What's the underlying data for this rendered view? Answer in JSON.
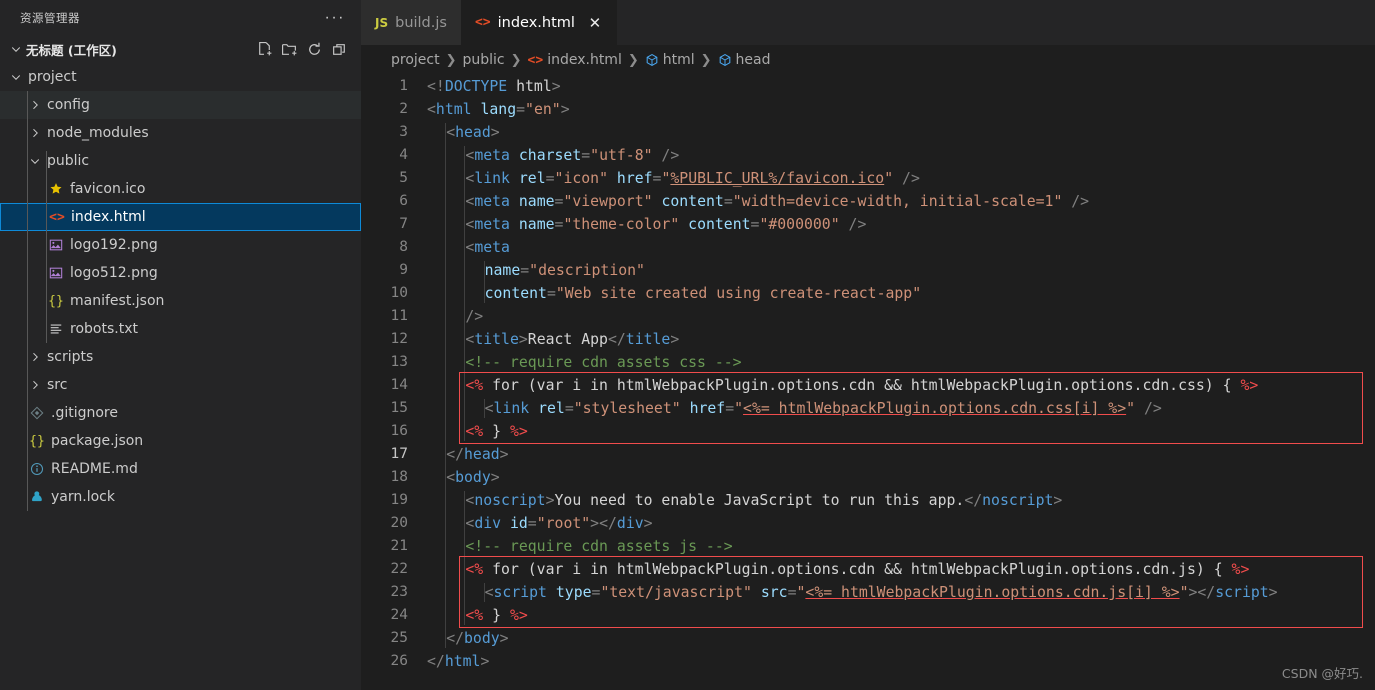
{
  "sidebar": {
    "title": "资源管理器",
    "more_label": "···",
    "workspace": {
      "name": "无标题 (工作区)",
      "expanded": true
    },
    "actions": [
      {
        "name": "new-file-icon",
        "label": "新建文件"
      },
      {
        "name": "new-folder-icon",
        "label": "新建文件夹"
      },
      {
        "name": "refresh-icon",
        "label": "刷新资源管理器"
      },
      {
        "name": "collapse-all-icon",
        "label": "在资源管理器中折叠文件夹"
      }
    ],
    "tree": [
      {
        "label": "project",
        "depth": 1,
        "kind": "folder",
        "expanded": true,
        "icon": "chevron-down-icon",
        "selected": false,
        "hover": false
      },
      {
        "label": "config",
        "depth": 2,
        "kind": "folder",
        "expanded": false,
        "icon": "chevron-right-icon",
        "selected": false,
        "hover": true
      },
      {
        "label": "node_modules",
        "depth": 2,
        "kind": "folder",
        "expanded": false,
        "icon": "chevron-right-icon",
        "selected": false,
        "hover": false
      },
      {
        "label": "public",
        "depth": 2,
        "kind": "folder",
        "expanded": true,
        "icon": "chevron-down-icon",
        "selected": false,
        "hover": false
      },
      {
        "label": "favicon.ico",
        "depth": 3,
        "kind": "file",
        "icon": "star-icon",
        "color": "#e8c200",
        "selected": false,
        "hover": false
      },
      {
        "label": "index.html",
        "depth": 3,
        "kind": "file",
        "icon": "html-icon",
        "color": "#e44d26",
        "selected": true,
        "hover": false
      },
      {
        "label": "logo192.png",
        "depth": 3,
        "kind": "file",
        "icon": "image-icon",
        "color": "#b180d7",
        "selected": false,
        "hover": false
      },
      {
        "label": "logo512.png",
        "depth": 3,
        "kind": "file",
        "icon": "image-icon",
        "color": "#b180d7",
        "selected": false,
        "hover": false
      },
      {
        "label": "manifest.json",
        "depth": 3,
        "kind": "file",
        "icon": "json-icon",
        "color": "#cbcb41",
        "selected": false,
        "hover": false
      },
      {
        "label": "robots.txt",
        "depth": 3,
        "kind": "file",
        "icon": "text-file-icon",
        "color": "#cccccc",
        "selected": false,
        "hover": false
      },
      {
        "label": "scripts",
        "depth": 2,
        "kind": "folder",
        "expanded": false,
        "icon": "chevron-right-icon",
        "selected": false,
        "hover": false
      },
      {
        "label": "src",
        "depth": 2,
        "kind": "folder",
        "expanded": false,
        "icon": "chevron-right-icon",
        "selected": false,
        "hover": false
      },
      {
        "label": ".gitignore",
        "depth": 2,
        "kind": "file",
        "icon": "git-icon",
        "color": "#6d8086",
        "selected": false,
        "hover": false
      },
      {
        "label": "package.json",
        "depth": 2,
        "kind": "file",
        "icon": "json-icon",
        "color": "#cbcb41",
        "selected": false,
        "hover": false
      },
      {
        "label": "README.md",
        "depth": 2,
        "kind": "file",
        "icon": "info-icon",
        "color": "#519aba",
        "selected": false,
        "hover": false
      },
      {
        "label": "yarn.lock",
        "depth": 2,
        "kind": "file",
        "icon": "yarn-icon",
        "color": "#2fa3c7",
        "selected": false,
        "hover": false
      }
    ]
  },
  "tabs": [
    {
      "label": "build.js",
      "icon": "js-icon",
      "icon_text": "JS",
      "icon_color": "#cbcb41",
      "active": false,
      "closable": false
    },
    {
      "label": "index.html",
      "icon": "html-icon",
      "icon_text": "<>",
      "icon_color": "#e44d26",
      "active": true,
      "closable": true,
      "close_label": "✕"
    }
  ],
  "breadcrumb": [
    {
      "label": "project",
      "icon": null
    },
    {
      "label": "public",
      "icon": null
    },
    {
      "label": "index.html",
      "icon": "html-icon"
    },
    {
      "label": "html",
      "icon": "symbol-field-icon"
    },
    {
      "label": "head",
      "icon": "symbol-field-icon"
    }
  ],
  "editor": {
    "active_line": 17,
    "first_line": 1,
    "last_line": 26,
    "lines": [
      {
        "n": 1,
        "indent": 0,
        "tokens": [
          {
            "t": "punc",
            "v": "<!"
          },
          {
            "t": "tag",
            "v": "DOCTYPE"
          },
          {
            "t": "txt",
            "v": " html"
          },
          {
            "t": "punc",
            "v": ">"
          }
        ]
      },
      {
        "n": 2,
        "indent": 0,
        "tokens": [
          {
            "t": "punc",
            "v": "<"
          },
          {
            "t": "tag",
            "v": "html"
          },
          {
            "t": "txt",
            "v": " "
          },
          {
            "t": "attr",
            "v": "lang"
          },
          {
            "t": "punc",
            "v": "="
          },
          {
            "t": "str",
            "v": "\"en\""
          },
          {
            "t": "punc",
            "v": ">"
          }
        ]
      },
      {
        "n": 3,
        "indent": 1,
        "tokens": [
          {
            "t": "punc",
            "v": "<"
          },
          {
            "t": "tag",
            "v": "head"
          },
          {
            "t": "punc",
            "v": ">"
          }
        ]
      },
      {
        "n": 4,
        "indent": 2,
        "tokens": [
          {
            "t": "punc",
            "v": "<"
          },
          {
            "t": "tag",
            "v": "meta"
          },
          {
            "t": "txt",
            "v": " "
          },
          {
            "t": "attr",
            "v": "charset"
          },
          {
            "t": "punc",
            "v": "="
          },
          {
            "t": "str",
            "v": "\"utf-8\""
          },
          {
            "t": "punc",
            "v": " />"
          }
        ]
      },
      {
        "n": 5,
        "indent": 2,
        "tokens": [
          {
            "t": "punc",
            "v": "<"
          },
          {
            "t": "tag",
            "v": "link"
          },
          {
            "t": "txt",
            "v": " "
          },
          {
            "t": "attr",
            "v": "rel"
          },
          {
            "t": "punc",
            "v": "="
          },
          {
            "t": "str",
            "v": "\"icon\""
          },
          {
            "t": "txt",
            "v": " "
          },
          {
            "t": "attr",
            "v": "href"
          },
          {
            "t": "punc",
            "v": "="
          },
          {
            "t": "str",
            "v": "\""
          },
          {
            "t": "link",
            "v": "%PUBLIC_URL%/favicon.ico"
          },
          {
            "t": "str",
            "v": "\""
          },
          {
            "t": "punc",
            "v": " />"
          }
        ]
      },
      {
        "n": 6,
        "indent": 2,
        "tokens": [
          {
            "t": "punc",
            "v": "<"
          },
          {
            "t": "tag",
            "v": "meta"
          },
          {
            "t": "txt",
            "v": " "
          },
          {
            "t": "attr",
            "v": "name"
          },
          {
            "t": "punc",
            "v": "="
          },
          {
            "t": "str",
            "v": "\"viewport\""
          },
          {
            "t": "txt",
            "v": " "
          },
          {
            "t": "attr",
            "v": "content"
          },
          {
            "t": "punc",
            "v": "="
          },
          {
            "t": "str",
            "v": "\"width=device-width, initial-scale=1\""
          },
          {
            "t": "punc",
            "v": " />"
          }
        ]
      },
      {
        "n": 7,
        "indent": 2,
        "tokens": [
          {
            "t": "punc",
            "v": "<"
          },
          {
            "t": "tag",
            "v": "meta"
          },
          {
            "t": "txt",
            "v": " "
          },
          {
            "t": "attr",
            "v": "name"
          },
          {
            "t": "punc",
            "v": "="
          },
          {
            "t": "str",
            "v": "\"theme-color\""
          },
          {
            "t": "txt",
            "v": " "
          },
          {
            "t": "attr",
            "v": "content"
          },
          {
            "t": "punc",
            "v": "="
          },
          {
            "t": "str",
            "v": "\"#000000\""
          },
          {
            "t": "punc",
            "v": " />"
          }
        ]
      },
      {
        "n": 8,
        "indent": 2,
        "tokens": [
          {
            "t": "punc",
            "v": "<"
          },
          {
            "t": "tag",
            "v": "meta"
          }
        ]
      },
      {
        "n": 9,
        "indent": 3,
        "tokens": [
          {
            "t": "attr",
            "v": "name"
          },
          {
            "t": "punc",
            "v": "="
          },
          {
            "t": "str",
            "v": "\"description\""
          }
        ]
      },
      {
        "n": 10,
        "indent": 3,
        "tokens": [
          {
            "t": "attr",
            "v": "content"
          },
          {
            "t": "punc",
            "v": "="
          },
          {
            "t": "str",
            "v": "\"Web site created using create-react-app\""
          }
        ]
      },
      {
        "n": 11,
        "indent": 2,
        "tokens": [
          {
            "t": "punc",
            "v": "/>"
          }
        ]
      },
      {
        "n": 12,
        "indent": 2,
        "tokens": [
          {
            "t": "punc",
            "v": "<"
          },
          {
            "t": "tag",
            "v": "title"
          },
          {
            "t": "punc",
            "v": ">"
          },
          {
            "t": "txt",
            "v": "React App"
          },
          {
            "t": "punc",
            "v": "</"
          },
          {
            "t": "tag",
            "v": "title"
          },
          {
            "t": "punc",
            "v": ">"
          }
        ]
      },
      {
        "n": 13,
        "indent": 2,
        "tokens": [
          {
            "t": "cmt",
            "v": "<!-- require cdn assets css -->"
          }
        ]
      },
      {
        "n": 14,
        "indent": 2,
        "tokens": [
          {
            "t": "err",
            "v": "<%"
          },
          {
            "t": "ejs",
            "v": " for (var i in htmlWebpackPlugin.options.cdn && htmlWebpackPlugin.options.cdn.css) { "
          },
          {
            "t": "err",
            "v": "%>"
          }
        ]
      },
      {
        "n": 15,
        "indent": 3,
        "tokens": [
          {
            "t": "punc",
            "v": "<"
          },
          {
            "t": "tag",
            "v": "link"
          },
          {
            "t": "txt",
            "v": " "
          },
          {
            "t": "attr",
            "v": "rel"
          },
          {
            "t": "punc",
            "v": "="
          },
          {
            "t": "str",
            "v": "\"stylesheet\""
          },
          {
            "t": "txt",
            "v": " "
          },
          {
            "t": "attr",
            "v": "href"
          },
          {
            "t": "punc",
            "v": "="
          },
          {
            "t": "str",
            "v": "\""
          },
          {
            "t": "errlink",
            "v": "<%= htmlWebpackPlugin.options.cdn.css[i] %>"
          },
          {
            "t": "str",
            "v": "\""
          },
          {
            "t": "punc",
            "v": " />"
          }
        ]
      },
      {
        "n": 16,
        "indent": 2,
        "tokens": [
          {
            "t": "err",
            "v": "<%"
          },
          {
            "t": "ejs",
            "v": " } "
          },
          {
            "t": "err",
            "v": "%>"
          }
        ]
      },
      {
        "n": 17,
        "indent": 1,
        "tokens": [
          {
            "t": "punc",
            "v": "</"
          },
          {
            "t": "tag",
            "v": "head"
          },
          {
            "t": "punc",
            "v": ">"
          }
        ]
      },
      {
        "n": 18,
        "indent": 1,
        "tokens": [
          {
            "t": "punc",
            "v": "<"
          },
          {
            "t": "tag",
            "v": "body"
          },
          {
            "t": "punc",
            "v": ">"
          }
        ]
      },
      {
        "n": 19,
        "indent": 2,
        "tokens": [
          {
            "t": "punc",
            "v": "<"
          },
          {
            "t": "tag",
            "v": "noscript"
          },
          {
            "t": "punc",
            "v": ">"
          },
          {
            "t": "txt",
            "v": "You need to enable JavaScript to run this app."
          },
          {
            "t": "punc",
            "v": "</"
          },
          {
            "t": "tag",
            "v": "noscript"
          },
          {
            "t": "punc",
            "v": ">"
          }
        ]
      },
      {
        "n": 20,
        "indent": 2,
        "tokens": [
          {
            "t": "punc",
            "v": "<"
          },
          {
            "t": "tag",
            "v": "div"
          },
          {
            "t": "txt",
            "v": " "
          },
          {
            "t": "attr",
            "v": "id"
          },
          {
            "t": "punc",
            "v": "="
          },
          {
            "t": "str",
            "v": "\"root\""
          },
          {
            "t": "punc",
            "v": "></"
          },
          {
            "t": "tag",
            "v": "div"
          },
          {
            "t": "punc",
            "v": ">"
          }
        ]
      },
      {
        "n": 21,
        "indent": 2,
        "tokens": [
          {
            "t": "cmt",
            "v": "<!-- require cdn assets js -->"
          }
        ]
      },
      {
        "n": 22,
        "indent": 2,
        "tokens": [
          {
            "t": "err",
            "v": "<%"
          },
          {
            "t": "ejs",
            "v": " for (var i in htmlWebpackPlugin.options.cdn && htmlWebpackPlugin.options.cdn.js) { "
          },
          {
            "t": "err",
            "v": "%>"
          }
        ]
      },
      {
        "n": 23,
        "indent": 3,
        "tokens": [
          {
            "t": "punc",
            "v": "<"
          },
          {
            "t": "tag",
            "v": "script"
          },
          {
            "t": "txt",
            "v": " "
          },
          {
            "t": "attr",
            "v": "type"
          },
          {
            "t": "punc",
            "v": "="
          },
          {
            "t": "str",
            "v": "\"text/javascript\""
          },
          {
            "t": "txt",
            "v": " "
          },
          {
            "t": "attr",
            "v": "src"
          },
          {
            "t": "punc",
            "v": "="
          },
          {
            "t": "str",
            "v": "\""
          },
          {
            "t": "errlink",
            "v": "<%= htmlWebpackPlugin.options.cdn.js[i] %>"
          },
          {
            "t": "str",
            "v": "\""
          },
          {
            "t": "punc",
            "v": "></"
          },
          {
            "t": "tag",
            "v": "script"
          },
          {
            "t": "punc",
            "v": ">"
          }
        ]
      },
      {
        "n": 24,
        "indent": 2,
        "tokens": [
          {
            "t": "err",
            "v": "<%"
          },
          {
            "t": "ejs",
            "v": " } "
          },
          {
            "t": "err",
            "v": "%>"
          }
        ]
      },
      {
        "n": 25,
        "indent": 1,
        "tokens": [
          {
            "t": "punc",
            "v": "</"
          },
          {
            "t": "tag",
            "v": "body"
          },
          {
            "t": "punc",
            "v": ">"
          }
        ]
      },
      {
        "n": 26,
        "indent": 0,
        "tokens": [
          {
            "t": "punc",
            "v": "</"
          },
          {
            "t": "tag",
            "v": "html"
          },
          {
            "t": "punc",
            "v": ">"
          }
        ]
      }
    ],
    "error_blocks": [
      {
        "from_line": 14,
        "to_line": 16,
        "label": "ejs-template-error-css"
      },
      {
        "from_line": 22,
        "to_line": 24,
        "label": "ejs-template-error-js"
      }
    ]
  },
  "watermark": "CSDN @好巧.",
  "colors": {
    "editor_bg": "#1e1e1e",
    "sidebar_bg": "#252526",
    "selection_bg": "#04395e",
    "selection_border": "#0e8ad8",
    "error": "#f14c4c",
    "tag": "#569cd6",
    "attr": "#9cdcfe",
    "string": "#ce9178",
    "comment": "#6a9955"
  }
}
